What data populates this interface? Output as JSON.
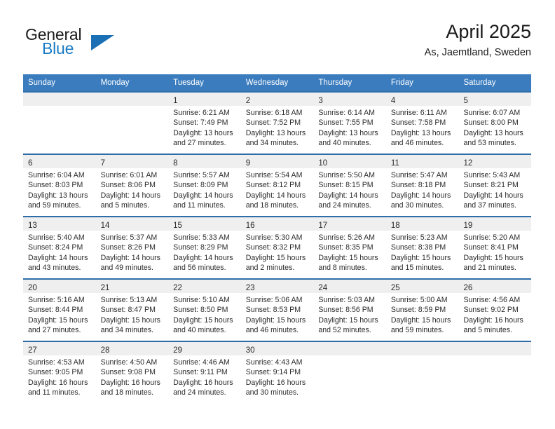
{
  "brand": {
    "name_top": "General",
    "name_bottom": "Blue",
    "accent_color": "#1a7bc4",
    "triangle_color": "#1a6fb5"
  },
  "header": {
    "title": "April 2025",
    "subtitle": "As, Jaemtland, Sweden"
  },
  "calendar": {
    "header_bg": "#3a7cbe",
    "row_border_color": "#2e6da8",
    "daynum_band_bg": "#efefef",
    "weekdays": [
      "Sunday",
      "Monday",
      "Tuesday",
      "Wednesday",
      "Thursday",
      "Friday",
      "Saturday"
    ],
    "weeks": [
      [
        {
          "day": "",
          "sunrise": "",
          "sunset": "",
          "daylight_line1": "",
          "daylight_line2": ""
        },
        {
          "day": "",
          "sunrise": "",
          "sunset": "",
          "daylight_line1": "",
          "daylight_line2": ""
        },
        {
          "day": "1",
          "sunrise": "Sunrise: 6:21 AM",
          "sunset": "Sunset: 7:49 PM",
          "daylight_line1": "Daylight: 13 hours",
          "daylight_line2": "and 27 minutes."
        },
        {
          "day": "2",
          "sunrise": "Sunrise: 6:18 AM",
          "sunset": "Sunset: 7:52 PM",
          "daylight_line1": "Daylight: 13 hours",
          "daylight_line2": "and 34 minutes."
        },
        {
          "day": "3",
          "sunrise": "Sunrise: 6:14 AM",
          "sunset": "Sunset: 7:55 PM",
          "daylight_line1": "Daylight: 13 hours",
          "daylight_line2": "and 40 minutes."
        },
        {
          "day": "4",
          "sunrise": "Sunrise: 6:11 AM",
          "sunset": "Sunset: 7:58 PM",
          "daylight_line1": "Daylight: 13 hours",
          "daylight_line2": "and 46 minutes."
        },
        {
          "day": "5",
          "sunrise": "Sunrise: 6:07 AM",
          "sunset": "Sunset: 8:00 PM",
          "daylight_line1": "Daylight: 13 hours",
          "daylight_line2": "and 53 minutes."
        }
      ],
      [
        {
          "day": "6",
          "sunrise": "Sunrise: 6:04 AM",
          "sunset": "Sunset: 8:03 PM",
          "daylight_line1": "Daylight: 13 hours",
          "daylight_line2": "and 59 minutes."
        },
        {
          "day": "7",
          "sunrise": "Sunrise: 6:01 AM",
          "sunset": "Sunset: 8:06 PM",
          "daylight_line1": "Daylight: 14 hours",
          "daylight_line2": "and 5 minutes."
        },
        {
          "day": "8",
          "sunrise": "Sunrise: 5:57 AM",
          "sunset": "Sunset: 8:09 PM",
          "daylight_line1": "Daylight: 14 hours",
          "daylight_line2": "and 11 minutes."
        },
        {
          "day": "9",
          "sunrise": "Sunrise: 5:54 AM",
          "sunset": "Sunset: 8:12 PM",
          "daylight_line1": "Daylight: 14 hours",
          "daylight_line2": "and 18 minutes."
        },
        {
          "day": "10",
          "sunrise": "Sunrise: 5:50 AM",
          "sunset": "Sunset: 8:15 PM",
          "daylight_line1": "Daylight: 14 hours",
          "daylight_line2": "and 24 minutes."
        },
        {
          "day": "11",
          "sunrise": "Sunrise: 5:47 AM",
          "sunset": "Sunset: 8:18 PM",
          "daylight_line1": "Daylight: 14 hours",
          "daylight_line2": "and 30 minutes."
        },
        {
          "day": "12",
          "sunrise": "Sunrise: 5:43 AM",
          "sunset": "Sunset: 8:21 PM",
          "daylight_line1": "Daylight: 14 hours",
          "daylight_line2": "and 37 minutes."
        }
      ],
      [
        {
          "day": "13",
          "sunrise": "Sunrise: 5:40 AM",
          "sunset": "Sunset: 8:24 PM",
          "daylight_line1": "Daylight: 14 hours",
          "daylight_line2": "and 43 minutes."
        },
        {
          "day": "14",
          "sunrise": "Sunrise: 5:37 AM",
          "sunset": "Sunset: 8:26 PM",
          "daylight_line1": "Daylight: 14 hours",
          "daylight_line2": "and 49 minutes."
        },
        {
          "day": "15",
          "sunrise": "Sunrise: 5:33 AM",
          "sunset": "Sunset: 8:29 PM",
          "daylight_line1": "Daylight: 14 hours",
          "daylight_line2": "and 56 minutes."
        },
        {
          "day": "16",
          "sunrise": "Sunrise: 5:30 AM",
          "sunset": "Sunset: 8:32 PM",
          "daylight_line1": "Daylight: 15 hours",
          "daylight_line2": "and 2 minutes."
        },
        {
          "day": "17",
          "sunrise": "Sunrise: 5:26 AM",
          "sunset": "Sunset: 8:35 PM",
          "daylight_line1": "Daylight: 15 hours",
          "daylight_line2": "and 8 minutes."
        },
        {
          "day": "18",
          "sunrise": "Sunrise: 5:23 AM",
          "sunset": "Sunset: 8:38 PM",
          "daylight_line1": "Daylight: 15 hours",
          "daylight_line2": "and 15 minutes."
        },
        {
          "day": "19",
          "sunrise": "Sunrise: 5:20 AM",
          "sunset": "Sunset: 8:41 PM",
          "daylight_line1": "Daylight: 15 hours",
          "daylight_line2": "and 21 minutes."
        }
      ],
      [
        {
          "day": "20",
          "sunrise": "Sunrise: 5:16 AM",
          "sunset": "Sunset: 8:44 PM",
          "daylight_line1": "Daylight: 15 hours",
          "daylight_line2": "and 27 minutes."
        },
        {
          "day": "21",
          "sunrise": "Sunrise: 5:13 AM",
          "sunset": "Sunset: 8:47 PM",
          "daylight_line1": "Daylight: 15 hours",
          "daylight_line2": "and 34 minutes."
        },
        {
          "day": "22",
          "sunrise": "Sunrise: 5:10 AM",
          "sunset": "Sunset: 8:50 PM",
          "daylight_line1": "Daylight: 15 hours",
          "daylight_line2": "and 40 minutes."
        },
        {
          "day": "23",
          "sunrise": "Sunrise: 5:06 AM",
          "sunset": "Sunset: 8:53 PM",
          "daylight_line1": "Daylight: 15 hours",
          "daylight_line2": "and 46 minutes."
        },
        {
          "day": "24",
          "sunrise": "Sunrise: 5:03 AM",
          "sunset": "Sunset: 8:56 PM",
          "daylight_line1": "Daylight: 15 hours",
          "daylight_line2": "and 52 minutes."
        },
        {
          "day": "25",
          "sunrise": "Sunrise: 5:00 AM",
          "sunset": "Sunset: 8:59 PM",
          "daylight_line1": "Daylight: 15 hours",
          "daylight_line2": "and 59 minutes."
        },
        {
          "day": "26",
          "sunrise": "Sunrise: 4:56 AM",
          "sunset": "Sunset: 9:02 PM",
          "daylight_line1": "Daylight: 16 hours",
          "daylight_line2": "and 5 minutes."
        }
      ],
      [
        {
          "day": "27",
          "sunrise": "Sunrise: 4:53 AM",
          "sunset": "Sunset: 9:05 PM",
          "daylight_line1": "Daylight: 16 hours",
          "daylight_line2": "and 11 minutes."
        },
        {
          "day": "28",
          "sunrise": "Sunrise: 4:50 AM",
          "sunset": "Sunset: 9:08 PM",
          "daylight_line1": "Daylight: 16 hours",
          "daylight_line2": "and 18 minutes."
        },
        {
          "day": "29",
          "sunrise": "Sunrise: 4:46 AM",
          "sunset": "Sunset: 9:11 PM",
          "daylight_line1": "Daylight: 16 hours",
          "daylight_line2": "and 24 minutes."
        },
        {
          "day": "30",
          "sunrise": "Sunrise: 4:43 AM",
          "sunset": "Sunset: 9:14 PM",
          "daylight_line1": "Daylight: 16 hours",
          "daylight_line2": "and 30 minutes."
        },
        {
          "day": "",
          "sunrise": "",
          "sunset": "",
          "daylight_line1": "",
          "daylight_line2": ""
        },
        {
          "day": "",
          "sunrise": "",
          "sunset": "",
          "daylight_line1": "",
          "daylight_line2": ""
        },
        {
          "day": "",
          "sunrise": "",
          "sunset": "",
          "daylight_line1": "",
          "daylight_line2": ""
        }
      ]
    ]
  }
}
